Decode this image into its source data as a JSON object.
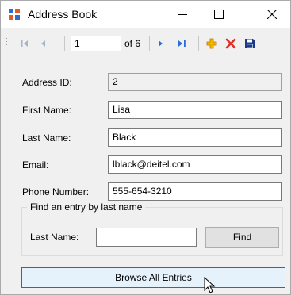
{
  "window": {
    "title": "Address Book"
  },
  "toolbar": {
    "position_value": "1",
    "count_text": "of 6"
  },
  "form": {
    "address_id": {
      "label": "Address ID:",
      "value": "2"
    },
    "first_name": {
      "label": "First Name:",
      "value": "Lisa"
    },
    "last_name": {
      "label": "Last Name:",
      "value": "Black"
    },
    "email": {
      "label": "Email:",
      "value": "lblack@deitel.com"
    },
    "phone": {
      "label": "Phone Number:",
      "value": "555-654-3210"
    }
  },
  "search": {
    "group_title": "Find an entry by last name",
    "label": "Last Name:",
    "value": "",
    "find_label": "Find"
  },
  "browse_label": "Browse All Entries",
  "icons": [
    "app-icon",
    "minimize-icon",
    "maximize-icon",
    "close-icon",
    "move-first-icon",
    "move-previous-icon",
    "move-next-icon",
    "move-last-icon",
    "add-new-icon",
    "delete-icon",
    "save-icon",
    "mouse-pointer-icon"
  ],
  "colors": {
    "accent_blue": "#2b6cd8",
    "delete_red": "#e0302a",
    "add_gold": "#f3b400",
    "save_navy": "#1a3b8c"
  }
}
